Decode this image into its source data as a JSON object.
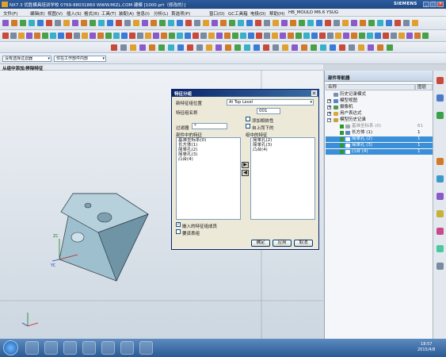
{
  "window": {
    "title": "NX7.3  优胜模具培训学校  0769-88031860  WWW.MIZL.COM  建模  [1000.prt（修改的）]",
    "brand": "SIEMENS"
  },
  "menu": [
    "文件(F)",
    "编辑(E)",
    "视图(V)",
    "插入(S)",
    "格式(R)",
    "工具(T)",
    "装配(A)",
    "信息(I)",
    "分析(L)",
    "首选项(P)",
    "窗口(O)",
    "GC工具箱",
    "电极(D)",
    "帮助(H)",
    "HB_MOULD M6.6",
    "YSUG"
  ],
  "selection_bar": {
    "filter": "没有选择过滤器",
    "scope": "仅在工作部件内部"
  },
  "cue": "从组中添加/移除特征",
  "dialog": {
    "title": "特征分组",
    "group_location_label": "新特征组位置",
    "group_location_value": "At Top Level",
    "group_name_label": "特征组名称",
    "group_name_value": "001",
    "add_dependents": "添加相依性",
    "bottom_up": "自上而下的",
    "filter_label": "过滤器",
    "filter_value": "*",
    "part_features_label": "部件中的特征",
    "part_features": [
      "基准坐标系(0)",
      "长方体(1)",
      "简单孔(2)",
      "简单孔(3)",
      "凸台(4)"
    ],
    "group_features_label": "组中的特征",
    "group_features": [
      "简单孔(2)",
      "简单孔(3)",
      "凸台(4)"
    ],
    "embed_members": "嵌入的特征组成员",
    "include_expr": "要该表组",
    "ok": "确定",
    "apply": "应用",
    "cancel": "取消"
  },
  "navigator": {
    "title": "部件导航器",
    "col_name": "名称",
    "col_layer": "图层",
    "nodes": [
      {
        "label": "历史记录模式",
        "num": ""
      },
      {
        "label": "模型视图",
        "num": ""
      },
      {
        "label": "摄像机",
        "num": ""
      },
      {
        "label": "用户表达式",
        "num": ""
      },
      {
        "label": "模型历史记录",
        "num": ""
      },
      {
        "label": "基准坐标系 (0)",
        "num": "61"
      },
      {
        "label": "长方体 (1)",
        "num": "1"
      },
      {
        "label": "简单孔 (2)",
        "num": "1"
      },
      {
        "label": "简单孔 (3)",
        "num": "1"
      },
      {
        "label": "凸台 (4)",
        "num": "1"
      }
    ]
  },
  "axes": {
    "zc": "ZC",
    "yc": "YC"
  },
  "clock": {
    "time": "18:57",
    "date": "2015/4/8"
  },
  "colors": {
    "titlebar": "#1f4a86",
    "highlight": "#3a8fd8",
    "block": "#8fb2c2"
  }
}
